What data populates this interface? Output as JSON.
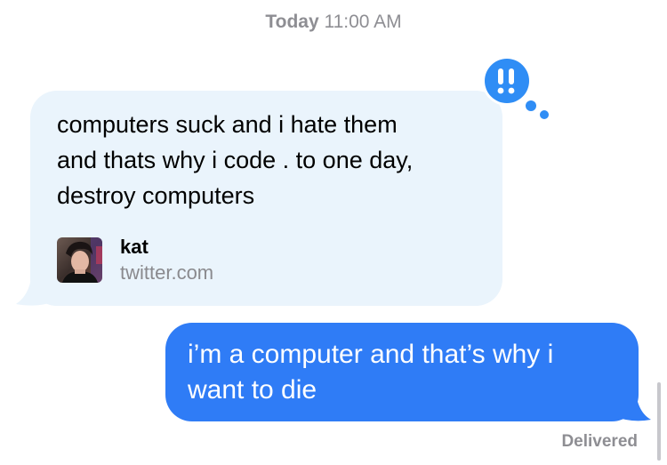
{
  "timestamp": {
    "day": "Today",
    "time": "11:00 AM"
  },
  "received_message": {
    "lines": [
      "computers suck and i hate them",
      "and thats why i code . to one day,",
      "destroy computers"
    ],
    "link_preview": {
      "name": "kat",
      "domain": "twitter.com"
    },
    "tapback": {
      "label": "!!",
      "color": "#2f8df5"
    },
    "bubble_color": "#eaf4fc"
  },
  "sent_message": {
    "lines": [
      "i’m a computer and that’s why i",
      "want to die"
    ],
    "bubble_color": "#2f7cf6",
    "status": "Delivered"
  }
}
